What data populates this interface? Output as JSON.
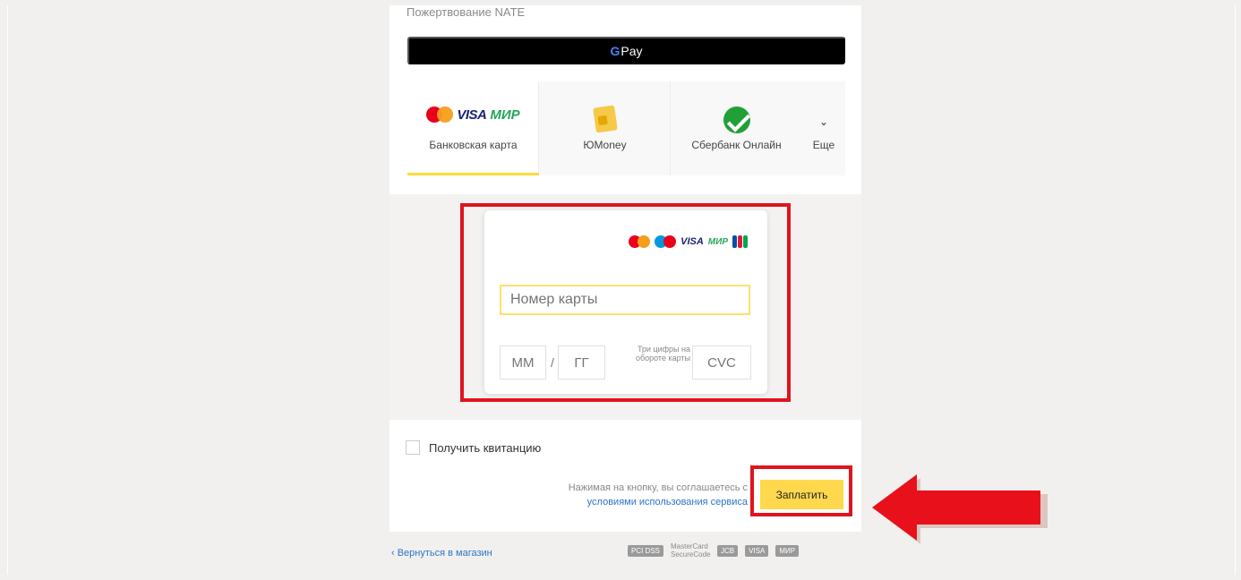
{
  "header": {
    "subtitle": "Пожертвование NATE"
  },
  "gpay": {
    "g": "G",
    "label": "Pay"
  },
  "tabs": [
    {
      "label": "Банковская карта",
      "visa": "VISA",
      "mir": "МИР"
    },
    {
      "label": "ЮMoney"
    },
    {
      "label": "Сбербанк Онлайн"
    },
    {
      "label": "Еще",
      "chevron": "⌄"
    }
  ],
  "form": {
    "logos": {
      "visa": "VISA",
      "mir": "МИР"
    },
    "card_number_placeholder": "Номер карты",
    "month_placeholder": "ММ",
    "slash": "/",
    "year_placeholder": "ГГ",
    "cvc_hint": "Три цифры на обороте карты",
    "cvc_placeholder": "CVC"
  },
  "receipt": {
    "label": "Получить квитанцию"
  },
  "agreement": {
    "text": "Нажимая на кнопку, вы соглашаетесь с",
    "link": "условиями использования сервиса"
  },
  "pay_button": {
    "label": "Заплатить"
  },
  "footer": {
    "back_link": "‹ Вернуться в магазин",
    "pci": "PCI DSS",
    "mastercard": "MasterCard SecureCode",
    "jcb": "JCB",
    "visa": "VISA",
    "mir": "МИР"
  },
  "colors": {
    "accent": "#ffd84d",
    "highlight": "#e0141e",
    "link": "#2a74c8"
  }
}
